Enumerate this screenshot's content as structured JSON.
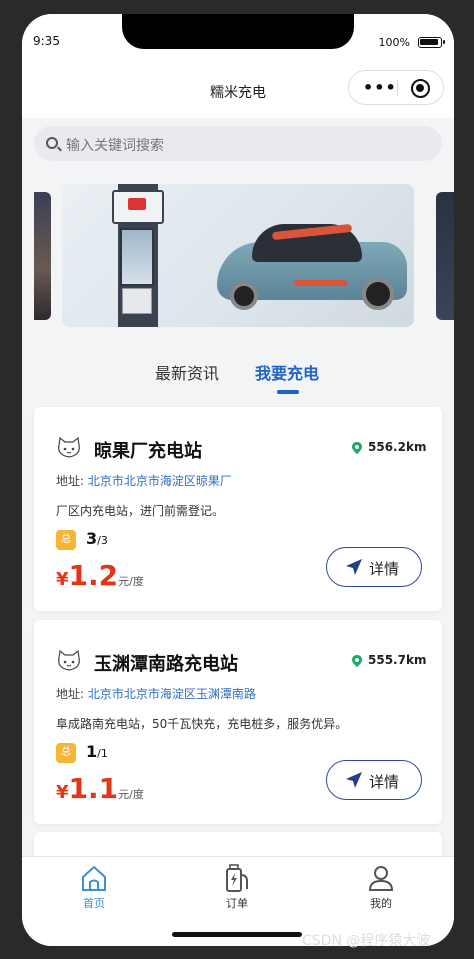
{
  "status_bar": {
    "time": "9:35",
    "battery_percent": "100%"
  },
  "nav": {
    "title": "糯米充电"
  },
  "search": {
    "placeholder": "输入关键词搜索"
  },
  "tabs": [
    {
      "label": "最新资讯",
      "active": false
    },
    {
      "label": "我要充电",
      "active": true
    }
  ],
  "stations": [
    {
      "name": "晾果厂充电站",
      "distance": "556.2km",
      "address_label": "地址:",
      "address": "北京市北京市海淀区晾果厂",
      "description": "厂区内充电站，进门前需登记。",
      "badge": "总",
      "available": "3",
      "total": "/3",
      "currency": "¥",
      "price": "1.2",
      "unit": "元/度",
      "detail_label": "详情"
    },
    {
      "name": "玉渊潭南路充电站",
      "distance": "555.7km",
      "address_label": "地址:",
      "address": "北京市北京市海淀区玉渊潭南路",
      "description": "阜成路南充电站，50千瓦快充，充电桩多，服务优异。",
      "badge": "总",
      "available": "1",
      "total": "/1",
      "currency": "¥",
      "price": "1.1",
      "unit": "元/度",
      "detail_label": "详情"
    }
  ],
  "bottom_nav": [
    {
      "label": "首页",
      "icon": "home-icon",
      "active": true
    },
    {
      "label": "订单",
      "icon": "charger-icon",
      "active": false
    },
    {
      "label": "我的",
      "icon": "user-icon",
      "active": false
    }
  ],
  "watermark": "CSDN @程序猿大波",
  "colors": {
    "accent": "#1f63c5",
    "price": "#e2351a",
    "badge": "#f7b537"
  }
}
